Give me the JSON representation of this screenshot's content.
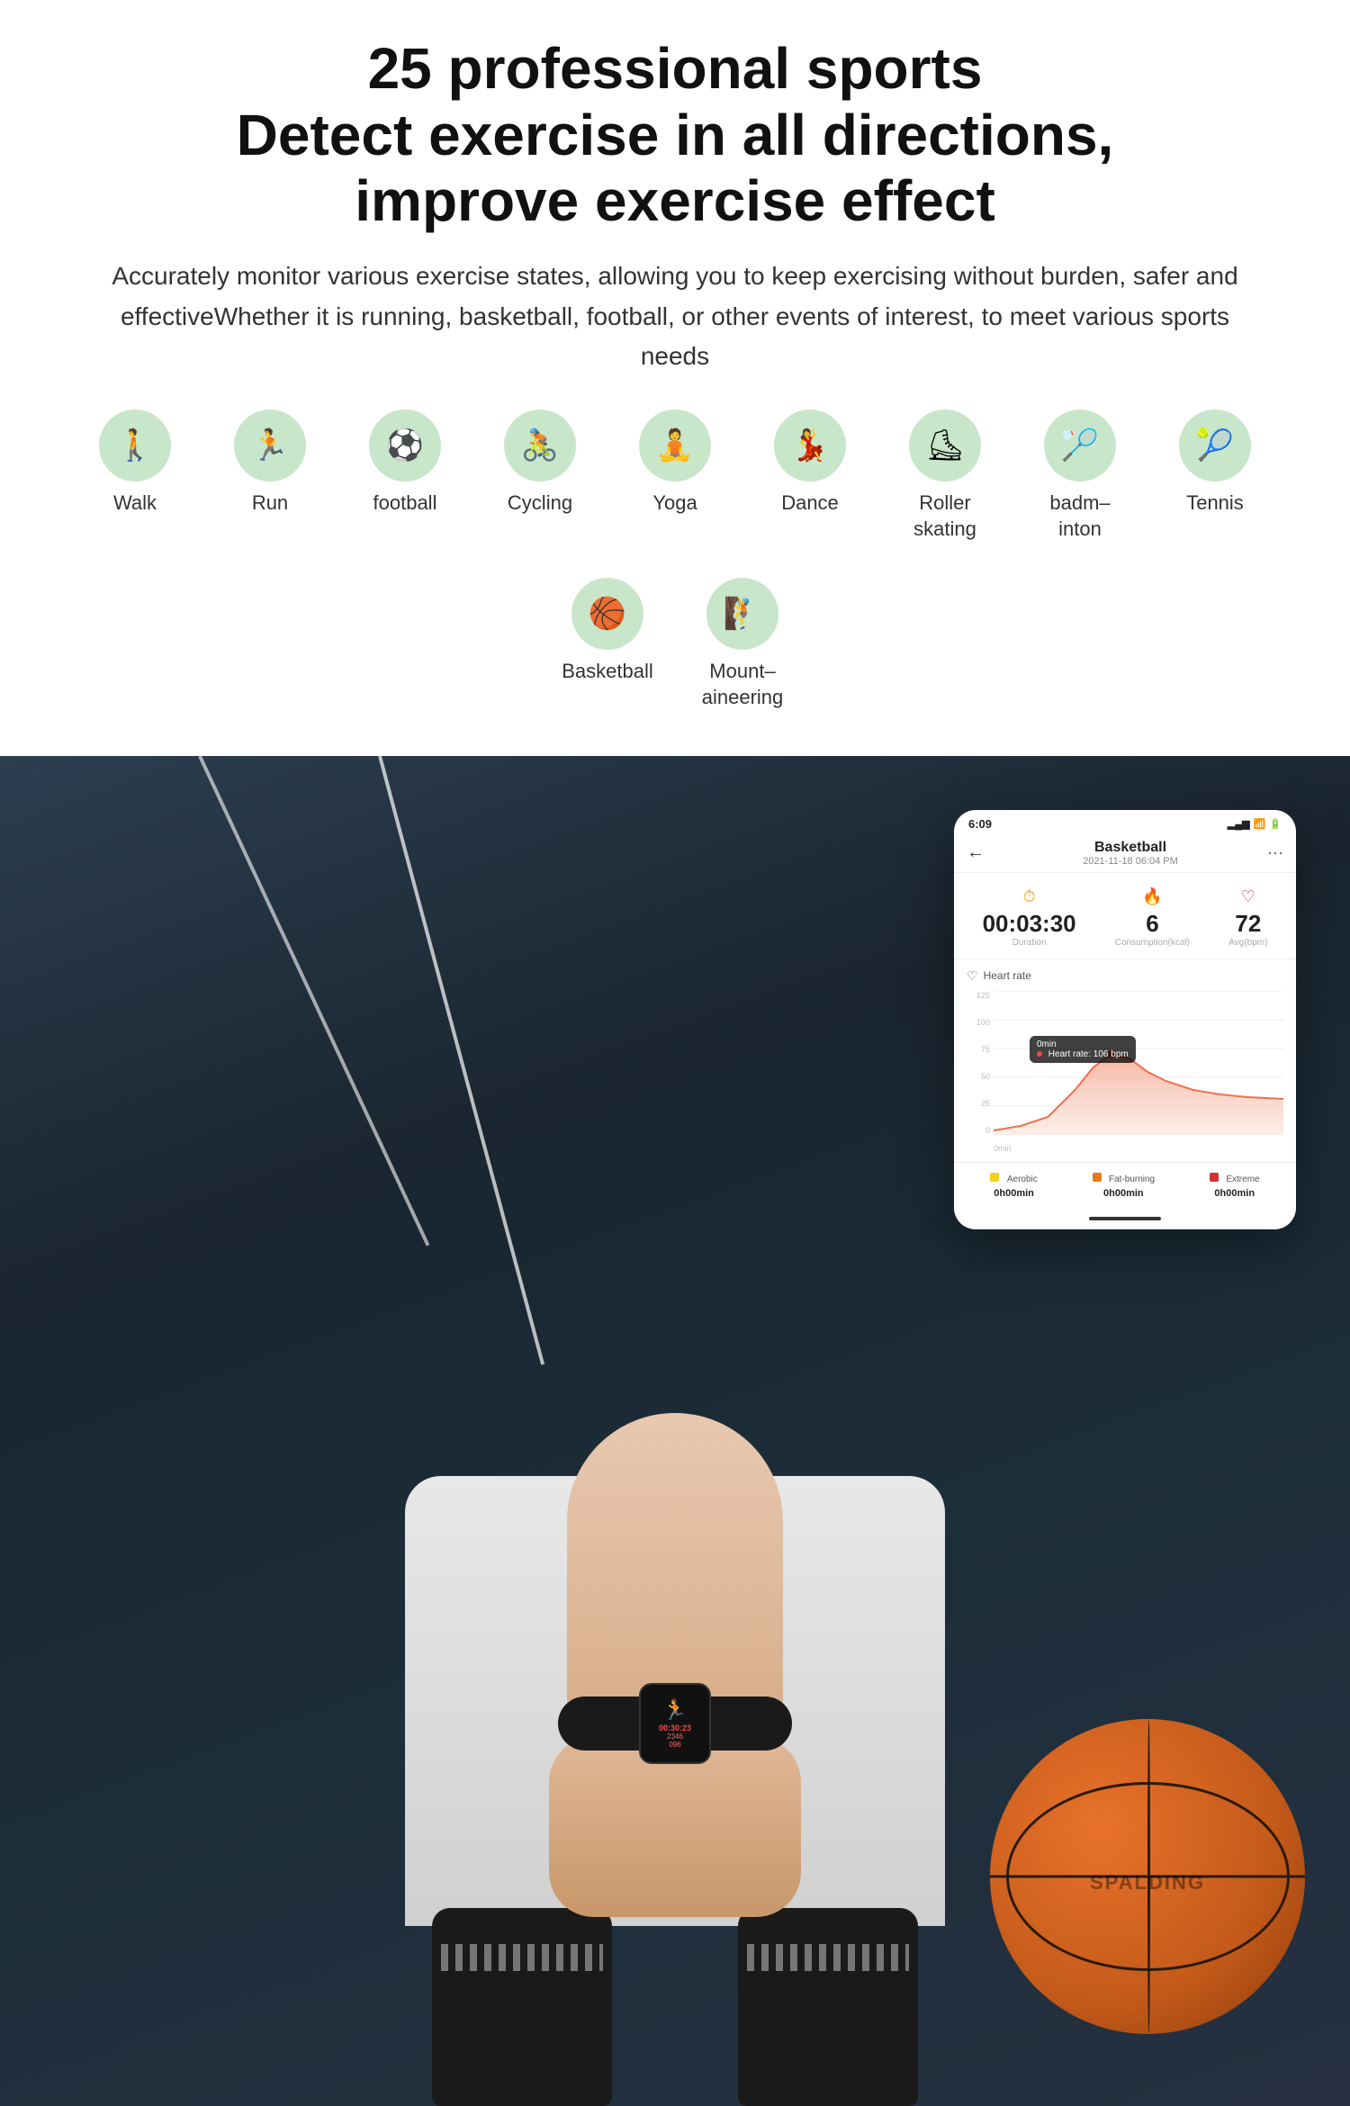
{
  "page": {
    "main_title_line1": "25 professional sports",
    "main_title_line2": "Detect exercise in all directions,",
    "main_title_line3": "improve exercise effect",
    "subtitle": "Accurately monitor various exercise states, allowing you to keep exercising without burden, safer and effectiveWhether it is running, basketball, football, or other events of interest, to meet various sports needs"
  },
  "sports": [
    {
      "id": "walk",
      "label": "Walk",
      "icon": "🚶"
    },
    {
      "id": "run",
      "label": "Run",
      "icon": "🏃"
    },
    {
      "id": "football",
      "label": "football",
      "icon": "⚽"
    },
    {
      "id": "cycling",
      "label": "Cycling",
      "icon": "🚴"
    },
    {
      "id": "yoga",
      "label": "Yoga",
      "icon": "🧘"
    },
    {
      "id": "dance",
      "label": "Dance",
      "icon": "💃"
    },
    {
      "id": "roller-skating",
      "label": "Roller skating",
      "icon": "⛸"
    },
    {
      "id": "badminton",
      "label": "badm–inton",
      "icon": "🏸"
    },
    {
      "id": "tennis",
      "label": "Tennis",
      "icon": "🎾"
    },
    {
      "id": "basketball",
      "label": "Basketball",
      "icon": "🏀"
    },
    {
      "id": "mountaineering",
      "label": "Mount–aineering",
      "icon": "🧗"
    }
  ],
  "phone_ui": {
    "status_time": "6:09",
    "activity_name": "Basketball",
    "activity_date": "2021-11-18 06:04 PM",
    "back_btn": "←",
    "more_btn": "···",
    "stats": [
      {
        "id": "duration",
        "icon": "⏱",
        "icon_color": "#f5a623",
        "value": "00:03:30",
        "label": "Duration"
      },
      {
        "id": "consumption",
        "icon": "🔥",
        "icon_color": "#e87722",
        "value": "6",
        "label": "Consumption(kcal)"
      },
      {
        "id": "avg_bpm",
        "icon": "♡",
        "icon_color": "#e0304a",
        "value": "72",
        "label": "Avg(bpm)"
      }
    ],
    "chart_title": "Heart rate",
    "chart_y_labels": [
      "125",
      "100",
      "75",
      "50",
      "25",
      "0"
    ],
    "chart_x_label": "0min",
    "tooltip_time": "0min",
    "tooltip_value": "Heart rate: 106 bpm",
    "zones": [
      {
        "id": "aerobic",
        "color": "#f5d020",
        "label": "Aerobic",
        "value": "0h00min"
      },
      {
        "id": "fat_burning",
        "color": "#e87722",
        "label": "Fat-burning",
        "value": "0h00min"
      },
      {
        "id": "extreme",
        "color": "#d32f2f",
        "label": "Extreme",
        "value": "0h00min"
      }
    ]
  },
  "band": {
    "runner_icon": "🏃",
    "time_display": "00:30:23",
    "steps": "2346",
    "heart_rate": "096"
  }
}
